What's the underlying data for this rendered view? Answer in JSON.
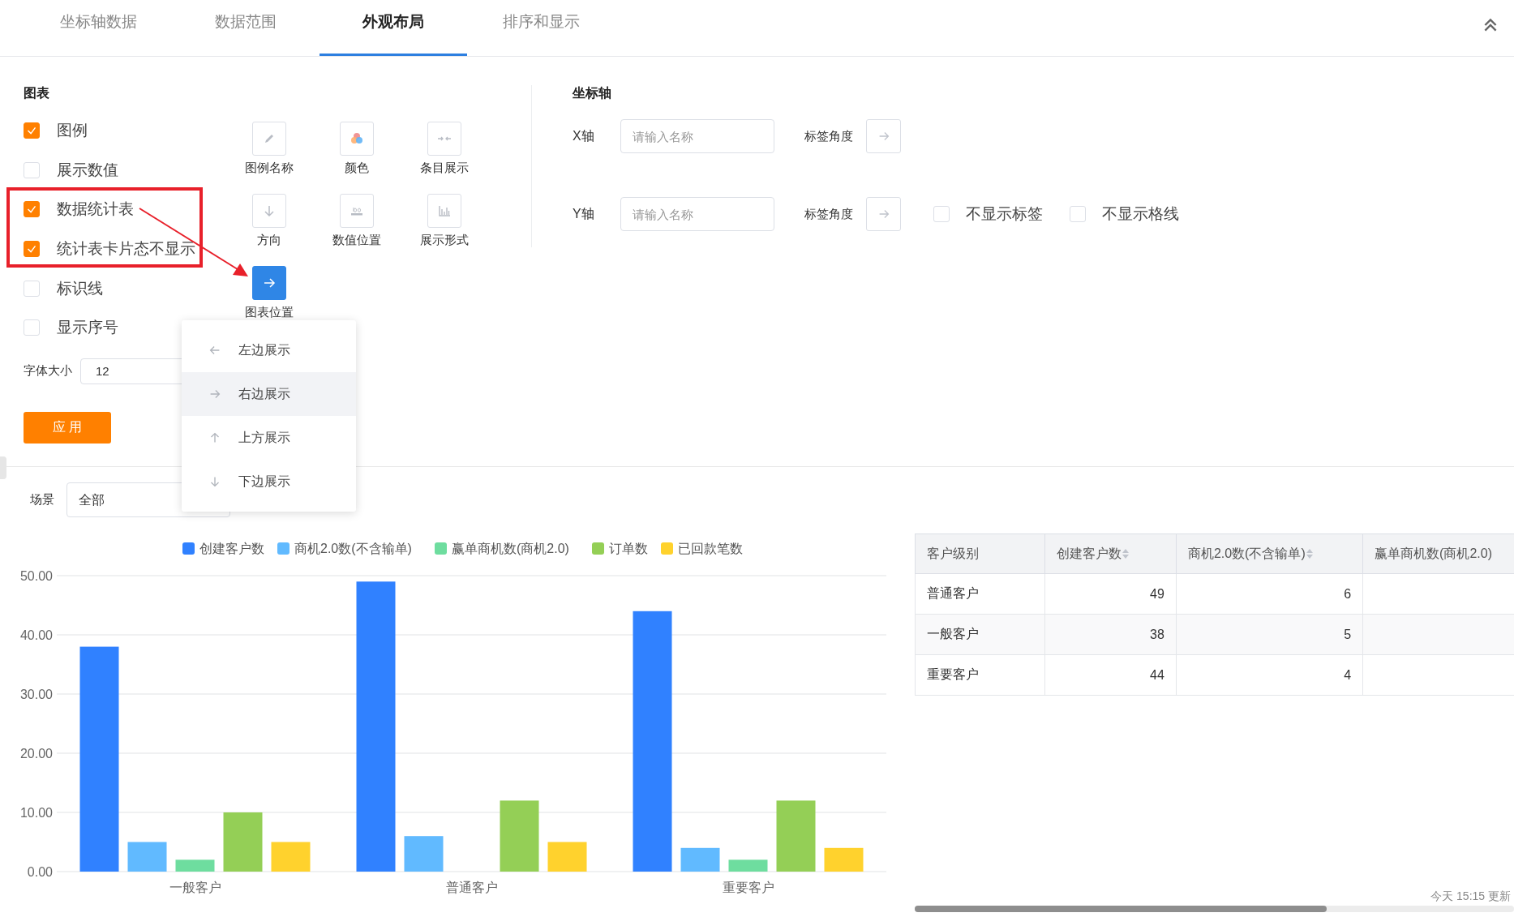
{
  "tabs": [
    {
      "label": "坐标轴数据",
      "selected": false
    },
    {
      "label": "数据范围",
      "selected": false
    },
    {
      "label": "外观布局",
      "selected": true
    },
    {
      "label": "排序和显示",
      "selected": false
    }
  ],
  "chart_settings": {
    "title": "图表",
    "options": [
      {
        "label": "图例",
        "checked": true
      },
      {
        "label": "展示数值",
        "checked": false
      },
      {
        "label": "数据统计表",
        "checked": true
      },
      {
        "label": "统计表卡片态不显示",
        "checked": true
      },
      {
        "label": "标识线",
        "checked": false
      },
      {
        "label": "显示序号",
        "checked": false
      }
    ],
    "tools": [
      {
        "label": "图例名称",
        "kind": "pencil",
        "selected": false
      },
      {
        "label": "颜色",
        "kind": "palette",
        "selected": false
      },
      {
        "label": "条目展示",
        "kind": "converge",
        "selected": false
      },
      {
        "label": "方向",
        "kind": "down",
        "selected": false
      },
      {
        "label": "数值位置",
        "kind": "value",
        "selected": false
      },
      {
        "label": "展示形式",
        "kind": "bars",
        "selected": false
      },
      {
        "label": "图表位置",
        "kind": "right",
        "selected": true
      }
    ],
    "font_size": {
      "label": "字体大小",
      "value": "12"
    },
    "apply_button": "应 用"
  },
  "position_menu": [
    {
      "label": "左边展示",
      "kind": "left",
      "selected": false
    },
    {
      "label": "右边展示",
      "kind": "right",
      "selected": true
    },
    {
      "label": "上方展示",
      "kind": "up",
      "selected": false
    },
    {
      "label": "下边展示",
      "kind": "down",
      "selected": false
    }
  ],
  "axis_settings": {
    "title": "坐标轴",
    "x_axis": {
      "label": "X轴",
      "placeholder": "请输入名称",
      "angle_label": "标签角度"
    },
    "y_axis": {
      "label": "Y轴",
      "placeholder": "请输入名称",
      "angle_label": "标签角度",
      "options": [
        {
          "label": "不显示标签",
          "checked": false
        },
        {
          "label": "不显示格线",
          "checked": false
        }
      ]
    }
  },
  "scene": {
    "label": "场景",
    "value": "全部"
  },
  "chart_data": {
    "type": "bar",
    "categories": [
      "一般客户",
      "普通客户",
      "重要客户"
    ],
    "ylim": [
      0,
      50
    ],
    "grid": true,
    "legend": true,
    "yticks": [
      {
        "value": 0,
        "label": "0.00"
      },
      {
        "value": 10,
        "label": "10.00"
      },
      {
        "value": 20,
        "label": "20.00"
      },
      {
        "value": 30,
        "label": "30.00"
      },
      {
        "value": 40,
        "label": "40.00"
      },
      {
        "value": 50,
        "label": "50.00"
      }
    ],
    "series": [
      {
        "name": "创建客户数",
        "color": "#3081ff",
        "values": [
          38,
          49,
          44
        ]
      },
      {
        "name": "商机2.0数(不含输单)",
        "color": "#61baff",
        "values": [
          5,
          6,
          4
        ]
      },
      {
        "name": "赢单商机数(商机2.0)",
        "color": "#6edd9f",
        "values": [
          2,
          0,
          2
        ]
      },
      {
        "name": "订单数",
        "color": "#94cf56",
        "values": [
          10,
          12,
          12
        ]
      },
      {
        "name": "已回款笔数",
        "color": "#ffd22d",
        "values": [
          5,
          5,
          4
        ]
      }
    ]
  },
  "table": {
    "columns": [
      {
        "label": "客户级别",
        "sortable": false
      },
      {
        "label": "创建客户数",
        "sortable": true
      },
      {
        "label": "商机2.0数(不含输单)",
        "sortable": true
      },
      {
        "label": "赢单商机数(商机2.0)",
        "sortable": false
      }
    ],
    "rows": [
      [
        "普通客户",
        "49",
        "6"
      ],
      [
        "一般客户",
        "38",
        "5"
      ],
      [
        "重要客户",
        "44",
        "4"
      ]
    ]
  },
  "update_time": "今天 15:15 更新"
}
